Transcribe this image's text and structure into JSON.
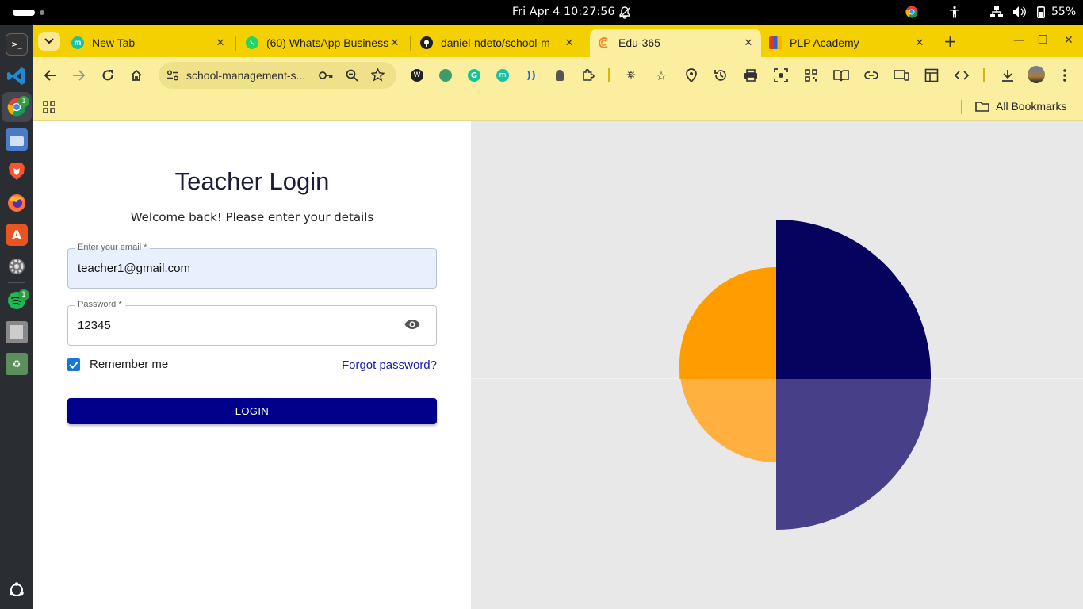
{
  "topbar": {
    "clock": "Fri Apr 4  10:27:56",
    "battery": "55%"
  },
  "dock": {
    "items": [
      "terminal-icon",
      "vscode-icon",
      "chrome-icon",
      "files-icon",
      "brave-icon",
      "firefox-icon",
      "app-center-icon",
      "settings-icon",
      "spotify-icon",
      "file-manager-icon",
      "trash-icon",
      "show-apps-icon"
    ],
    "chrome_badge": "1",
    "spotify_badge": "1"
  },
  "tabs": [
    {
      "title": "New Tab",
      "icon": "m"
    },
    {
      "title": "(60) WhatsApp Business",
      "icon": ""
    },
    {
      "title": "daniel-ndeto/school-m",
      "icon": ""
    },
    {
      "title": "Edu-365",
      "icon": ""
    },
    {
      "title": "PLP Academy",
      "icon": ""
    }
  ],
  "omnibox": {
    "url": "school-management-s..."
  },
  "bookmarks": {
    "all_label": "All Bookmarks"
  },
  "login": {
    "title": "Teacher Login",
    "subtitle": "Welcome back! Please enter your details",
    "email_label": "Enter your email *",
    "email_value": "teacher1@gmail.com",
    "password_label": "Password *",
    "password_value": "12345",
    "remember_label": "Remember me",
    "remember_checked": true,
    "forgot_label": "Forgot password?",
    "login_button": "LOGIN"
  },
  "colors": {
    "tabstrip": "#f5d000",
    "toolbar": "#fbef9f",
    "login_button": "#00008b",
    "art_navy": "#05035d",
    "art_orange": "#ff9c00",
    "art_orange_light": "#ffb03f",
    "art_purple": "#473f88"
  }
}
